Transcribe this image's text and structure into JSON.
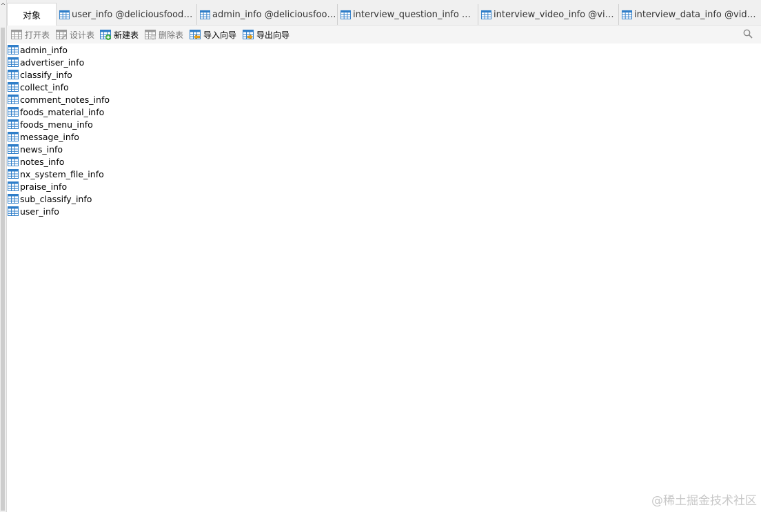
{
  "tabs": [
    {
      "label": "对象",
      "active": true
    },
    {
      "label": "user_info @deliciousfoods (l...",
      "active": false
    },
    {
      "label": "admin_info @deliciousfoods...",
      "active": false
    },
    {
      "label": "interview_question_info @vid...",
      "active": false
    },
    {
      "label": "interview_video_info @video...",
      "active": false
    },
    {
      "label": "interview_data_info @video-i...",
      "active": false
    }
  ],
  "toolbar": {
    "open_table": "打开表",
    "design_table": "设计表",
    "new_table": "新建表",
    "delete_table": "删除表",
    "import_wizard": "导入向导",
    "export_wizard": "导出向导"
  },
  "tables": [
    "admin_info",
    "advertiser_info",
    "classify_info",
    "collect_info",
    "comment_notes_info",
    "foods_material_info",
    "foods_menu_info",
    "message_info",
    "news_info",
    "notes_info",
    "nx_system_file_info",
    "praise_info",
    "sub_classify_info",
    "user_info"
  ],
  "watermark": "@稀土掘金技术社区",
  "colors": {
    "table_icon": "#2f7ec9",
    "add_badge": "#3aa83a"
  }
}
